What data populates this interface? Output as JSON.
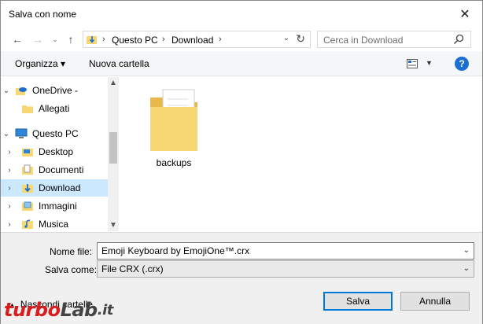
{
  "window": {
    "title": "Salva con nome"
  },
  "address": {
    "crumbs": [
      "Questo PC",
      "Download"
    ]
  },
  "search": {
    "placeholder": "Cerca in Download"
  },
  "toolbar": {
    "organize_label": "Organizza ▾",
    "new_folder_label": "Nuova cartella"
  },
  "nav": {
    "items": [
      {
        "label": "OneDrive -",
        "icon": "onedrive-icon",
        "expander": "⌄"
      },
      {
        "label": "Allegati",
        "icon": "folder-icon",
        "expander": ""
      },
      {
        "label": "Questo PC",
        "icon": "computer-icon",
        "expander": "⌄"
      },
      {
        "label": "Desktop",
        "icon": "desktop-folder-icon",
        "expander": "›"
      },
      {
        "label": "Documenti",
        "icon": "documents-folder-icon",
        "expander": "›"
      },
      {
        "label": "Download",
        "icon": "download-folder-icon",
        "expander": "›",
        "selected": true
      },
      {
        "label": "Immagini",
        "icon": "pictures-folder-icon",
        "expander": "›"
      },
      {
        "label": "Musica",
        "icon": "music-folder-icon",
        "expander": "›"
      }
    ]
  },
  "files": [
    {
      "name": "backups",
      "icon": "folder-icon"
    }
  ],
  "form": {
    "filename_label": "Nome file:",
    "filename_value": "Emoji Keyboard by EmojiOne™.crx",
    "type_label": "Salva come:",
    "type_value": "File CRX (.crx)"
  },
  "footer": {
    "hide_folders_label": "Nascondi cartelle"
  },
  "buttons": {
    "save_label": "Salva",
    "cancel_label": "Annulla"
  },
  "watermark": {
    "part1": "turbo",
    "part2": "Lab",
    "part3": ".it"
  },
  "colors": {
    "accent": "#0078d7",
    "selected": "#cce8ff",
    "folder": "#f8d775",
    "watermark_red": "#d81e1e",
    "watermark_dark": "#444444"
  }
}
